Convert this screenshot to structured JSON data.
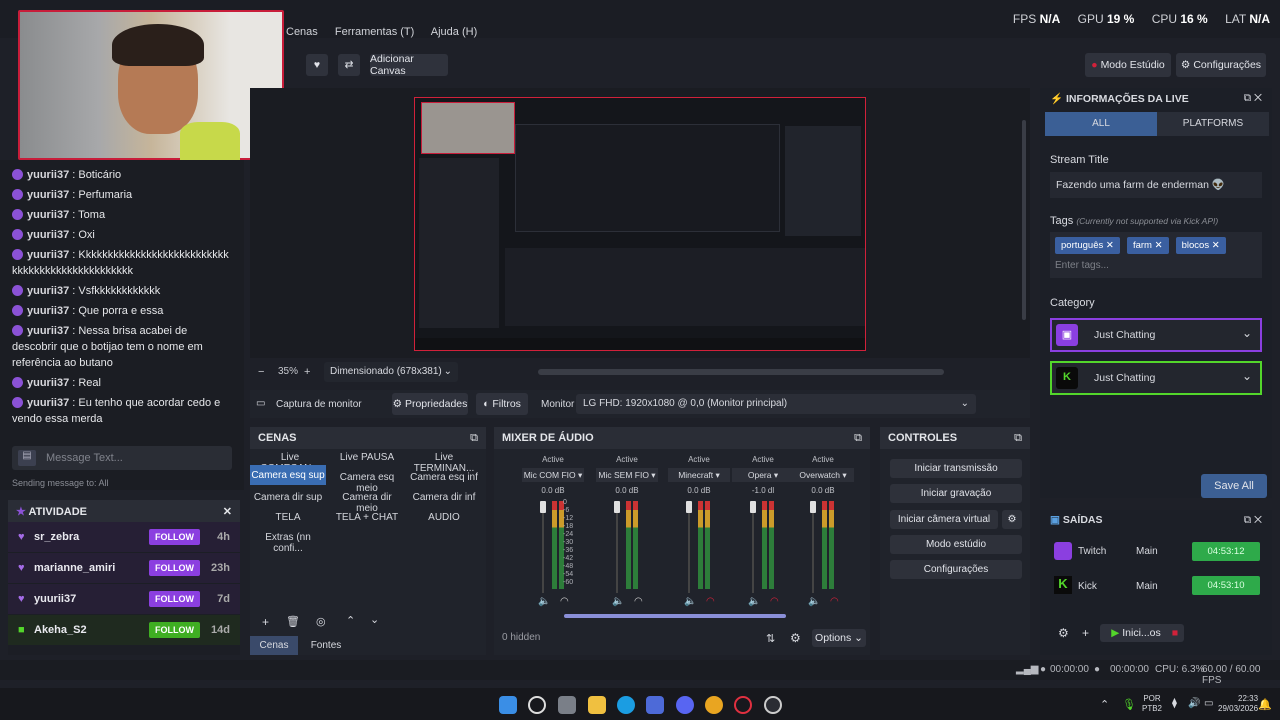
{
  "topbar": {
    "menus": [
      "Cenas",
      "Ferramentas (T)",
      "Ajuda (H)"
    ],
    "fps_label": "FPS",
    "fps": "N/A",
    "gpu_label": "GPU",
    "gpu": "19 %",
    "cpu_label": "CPU",
    "cpu": "16 %",
    "lat_label": "LAT",
    "lat": "N/A"
  },
  "toolbar": {
    "add_canvas": "Adicionar Canvas",
    "studio_mode": "Modo Estúdio",
    "settings": "Configurações"
  },
  "chat": {
    "messages": [
      {
        "user": "yuurii37",
        "text": " : Boticário"
      },
      {
        "user": "yuurii37",
        "text": " : Perfumaria"
      },
      {
        "user": "yuurii37",
        "text": " : Toma"
      },
      {
        "user": "yuurii37",
        "text": " : Oxi"
      },
      {
        "user": "yuurii37",
        "text": " : Kkkkkkkkkkkkkkkkkkkkkkkkkkkkkkkkkkkkkkkkkkkkkkkkk"
      },
      {
        "user": "yuurii37",
        "text": " : Vsfkkkkkkkkkkkk"
      },
      {
        "user": "yuurii37",
        "text": " : Que porra e essa"
      },
      {
        "user": "yuurii37",
        "text": " : Nessa brisa acabei de descobrir que o botijao tem o nome em referência ao butano"
      },
      {
        "user": "yuurii37",
        "text": " : Real"
      },
      {
        "user": "yuurii37",
        "text": " : Eu tenho que acordar cedo e vendo essa merda"
      }
    ],
    "placeholder": "Message Text...",
    "sending": "Sending message to: All"
  },
  "activity": {
    "title": "ATIVIDADE",
    "follow": "FOLLOW",
    "rows": [
      {
        "name": "sr_zebra",
        "time": "4h"
      },
      {
        "name": "marianne_amiri",
        "time": "23h"
      },
      {
        "name": "yuurii37",
        "time": "7d"
      },
      {
        "name": "Akeha_S2",
        "time": "14d"
      }
    ]
  },
  "canvas": {
    "zoom": "35%",
    "minus": "−",
    "plus": "+",
    "scaling": "Dimensionado (678x381)"
  },
  "source": {
    "name": "Captura de monitor",
    "props": "Propriedades",
    "filters": "Filtros",
    "monitor_label": "Monitor",
    "monitor_value": "LG FHD: 1920x1080 @ 0,0 (Monitor principal)"
  },
  "scenes": {
    "title": "CENAS",
    "items": [
      "Live COMEÇAN...",
      "Live PAUSA",
      "Live TERMINAN...",
      "Camera esq sup",
      "Camera esq meio",
      "Camera esq inf",
      "Camera dir sup",
      "Camera dir meio",
      "Camera dir inf",
      "TELA",
      "TELA + CHAT",
      "AUDIO",
      "Extras (nn confi..."
    ],
    "tab_scenes": "Cenas",
    "tab_sources": "Fontes"
  },
  "mixer": {
    "title": "MIXER DE ÁUDIO",
    "hidden": "0 hidden",
    "options": "Options",
    "channels": [
      {
        "status": "Active",
        "name": "Mic COM FIO",
        "db": "0.0 dB",
        "level": 0.45
      },
      {
        "status": "Active",
        "name": "Mic SEM FIO",
        "db": "0.0 dB",
        "level": 0.3
      },
      {
        "status": "Active",
        "name": "Minecraft",
        "db": "0.0 dB",
        "level": 0.0
      },
      {
        "status": "Active",
        "name": "Opera",
        "db": "-1.0 dl",
        "level": 0.0
      },
      {
        "status": "Active",
        "name": "Overwatch",
        "db": "0.0 dB",
        "level": 0.0
      }
    ],
    "scale": [
      "0",
      "-6",
      "-12",
      "-18",
      "-24",
      "-30",
      "-36",
      "-42",
      "-48",
      "-54",
      "-60"
    ]
  },
  "controls": {
    "title": "CONTROLES",
    "buttons": [
      "Iniciar transmissão",
      "Iniciar gravação",
      "Iniciar câmera virtual",
      "Modo estúdio",
      "Configurações"
    ]
  },
  "live_info": {
    "title": "INFORMAÇÕES DA LIVE",
    "tab_all": "ALL",
    "tab_platforms": "PLATFORMS",
    "stream_title_label": "Stream Title",
    "stream_title": "Fazendo uma farm de enderman 👽",
    "tags_label": "Tags",
    "tags_note": "(Currently not supported via Kick API)",
    "tags": [
      "português",
      "farm",
      "blocos"
    ],
    "tags_placeholder": "Enter tags...",
    "category_label": "Category",
    "category_twitch": "Just Chatting",
    "category_kick": "Just Chatting",
    "save": "Save All"
  },
  "outputs": {
    "title": "SAÍDAS",
    "rows": [
      {
        "platform": "Twitch",
        "mode": "Main",
        "time": "04:53:12"
      },
      {
        "platform": "Kick",
        "mode": "Main",
        "time": "04:53:10"
      }
    ],
    "start": "Inici...os"
  },
  "statusbar": {
    "time1": "00:00:00",
    "time2": "00:00:00",
    "cpu": "CPU: 6.3%",
    "fps": "60.00 / 60.00 FPS"
  },
  "taskbar": {
    "lang": "POR",
    "lang2": "PTB2",
    "time": "22:33",
    "date": "29/03/2026"
  },
  "colors": {
    "accent_purple": "#8b3fe0",
    "kick_green": "#53d62b",
    "live_red": "#d1213a"
  }
}
